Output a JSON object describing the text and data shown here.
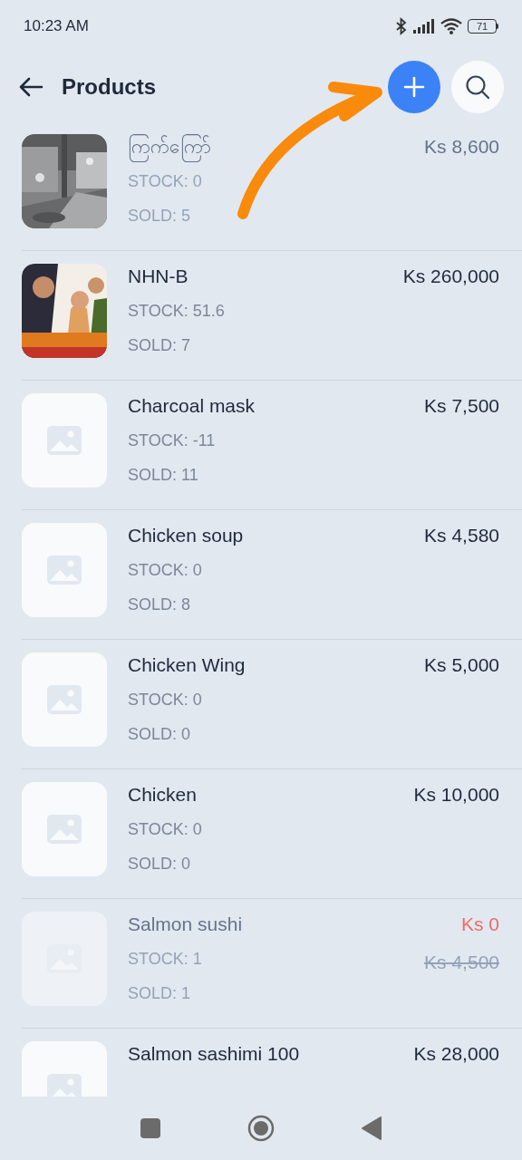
{
  "status_bar": {
    "time": "10:23 AM",
    "battery": "71"
  },
  "header": {
    "title": "Products"
  },
  "products": [
    {
      "name": "ကြက်ကြော်",
      "stock": "STOCK: 0",
      "sold": "SOLD: 5",
      "price": "Ks 8,600",
      "disabled": true
    },
    {
      "kind": "poster",
      "name": "NHN-B",
      "stock": "STOCK: 51.6",
      "sold": "SOLD: 7",
      "price": "Ks 260,000",
      "disabled": false
    },
    {
      "kind": "placeholder",
      "name": "Charcoal mask",
      "stock": "STOCK: -11",
      "sold": "SOLD: 11",
      "price": "Ks 7,500",
      "disabled": false
    },
    {
      "kind": "placeholder",
      "name": "Chicken soup",
      "stock": "STOCK: 0",
      "sold": "SOLD: 8",
      "price": "Ks 4,580",
      "disabled": false
    },
    {
      "kind": "placeholder",
      "name": "Chicken Wing",
      "stock": "STOCK: 0",
      "sold": "SOLD: 0",
      "price": "Ks 5,000",
      "disabled": false
    },
    {
      "kind": "placeholder",
      "name": "Chicken",
      "stock": "STOCK: 0",
      "sold": "SOLD: 0",
      "price": "Ks 10,000",
      "disabled": false
    },
    {
      "kind": "placeholder",
      "name": "Salmon sushi",
      "stock": "STOCK: 1",
      "sold": "SOLD: 1",
      "price": "Ks 0",
      "original_price": "Ks 4,500",
      "disabled": true
    },
    {
      "kind": "placeholder",
      "name": "Salmon sashimi 100",
      "price": "Ks 28,000",
      "disabled": false
    }
  ]
}
